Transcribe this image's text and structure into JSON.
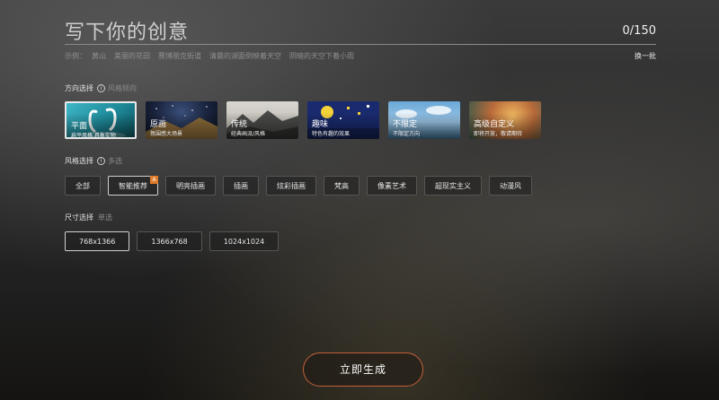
{
  "header": {
    "title": "写下你的创意",
    "counter": "0/150",
    "examples_label": "示例：",
    "examples": [
      "黄山",
      "美丽的花田",
      "赛博朋克街道",
      "清晨的湖面倒映着天空",
      "阴暗的天空下着小雨"
    ],
    "swap_label": "换一批"
  },
  "direction": {
    "label": "方向选择",
    "hint": "风格倾向",
    "cards": [
      {
        "name": "平面",
        "desc": "扁平风格,具象实物",
        "selected": true
      },
      {
        "name": "原画",
        "desc": "氛围感大场景",
        "selected": false
      },
      {
        "name": "传统",
        "desc": "经典画派/风格",
        "selected": false
      },
      {
        "name": "趣味",
        "desc": "特色有趣的效果",
        "selected": false
      },
      {
        "name": "不限定",
        "desc": "不限定方向",
        "selected": false
      },
      {
        "name": "高级自定义",
        "desc": "即将开放，敬请期待",
        "selected": false
      }
    ]
  },
  "style": {
    "label": "风格选择",
    "hint": "多选",
    "options": [
      {
        "label": "全部",
        "selected": false
      },
      {
        "label": "智能推荐",
        "selected": true,
        "badge": true
      },
      {
        "label": "明亮插画",
        "selected": false
      },
      {
        "label": "插画",
        "selected": false
      },
      {
        "label": "炫彩插画",
        "selected": false
      },
      {
        "label": "梵高",
        "selected": false
      },
      {
        "label": "像素艺术",
        "selected": false
      },
      {
        "label": "超现实主义",
        "selected": false
      },
      {
        "label": "动漫风",
        "selected": false
      }
    ]
  },
  "size": {
    "label": "尺寸选择",
    "hint": "单选",
    "options": [
      {
        "label": "768x1366",
        "selected": true
      },
      {
        "label": "1366x768",
        "selected": false
      },
      {
        "label": "1024x1024",
        "selected": false
      }
    ]
  },
  "generate_label": "立即生成",
  "colors": {
    "accent_border": "#c2603a",
    "badge": "#e07c2a"
  }
}
